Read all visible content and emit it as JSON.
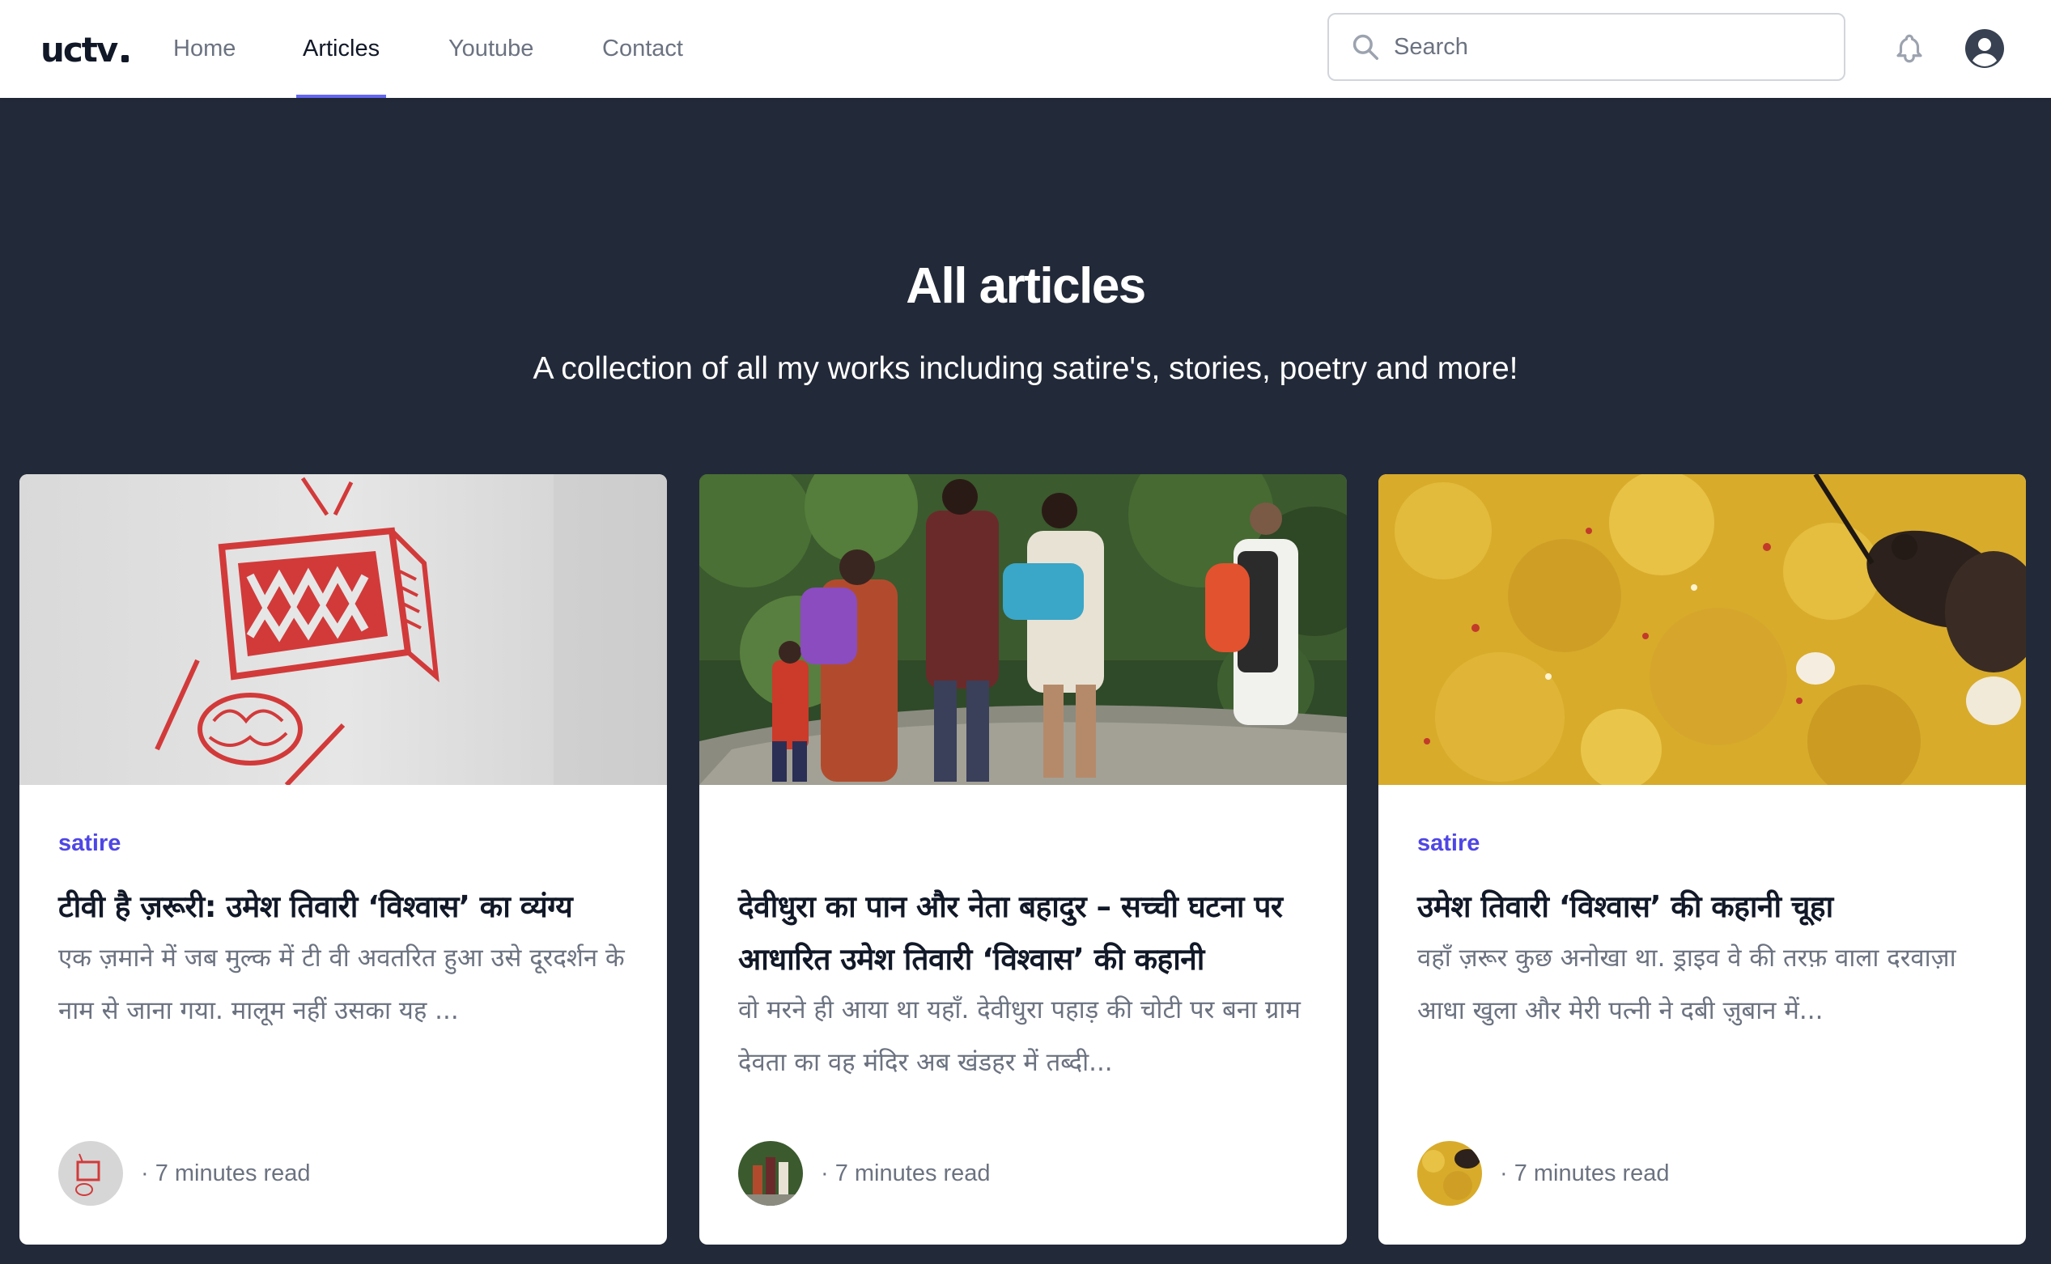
{
  "brand": {
    "logo_text": "uctv"
  },
  "nav": {
    "links": [
      {
        "label": "Home",
        "active": false
      },
      {
        "label": "Articles",
        "active": true
      },
      {
        "label": "Youtube",
        "active": false
      },
      {
        "label": "Contact",
        "active": false
      }
    ],
    "search_placeholder": "Search"
  },
  "hero": {
    "title": "All articles",
    "subtitle": "A collection of all my works including satire's, stories, poetry and more!"
  },
  "articles": [
    {
      "category": "satire",
      "title": "टीवी है ज़रूरी: उमेश तिवारी ‘विश्वास’ का व्यंग्य",
      "excerpt": "एक ज़माने में जब मुल्क में टी वी अवतरित हुआ उसे दूरदर्शन के नाम से जाना गया. मालूम नहीं उसका यह ...",
      "meta": "· 7 minutes read",
      "image": "tv-brain-graffiti"
    },
    {
      "category": "",
      "title": "देवीधुरा का पान और नेता बहादुर – सच्ची घटना पर आधारित उमेश तिवारी ‘विश्वास’ की कहानी",
      "excerpt": "वो मरने ही आया था यहाँ. देवीधुरा पहाड़ की चोटी पर बना ग्राम देवता का वह मंदिर अब खंडहर में तब्दी...",
      "meta": "· 7 minutes read",
      "image": "family-walking"
    },
    {
      "category": "satire",
      "title": "उमेश तिवारी ‘विश्वास’ की कहानी चूहा",
      "excerpt": "वहाँ ज़रूर कुछ अनोखा था. ड्राइव वे की तरफ़ वाला दरवाज़ा आधा खुला और मेरी पत्नी ने दबी ज़ुबान में...",
      "meta": "· 7 minutes read",
      "image": "rat-on-food"
    }
  ],
  "colors": {
    "accent": "#6366f1",
    "category": "#4f46e5",
    "hero_bg": "#222938"
  }
}
